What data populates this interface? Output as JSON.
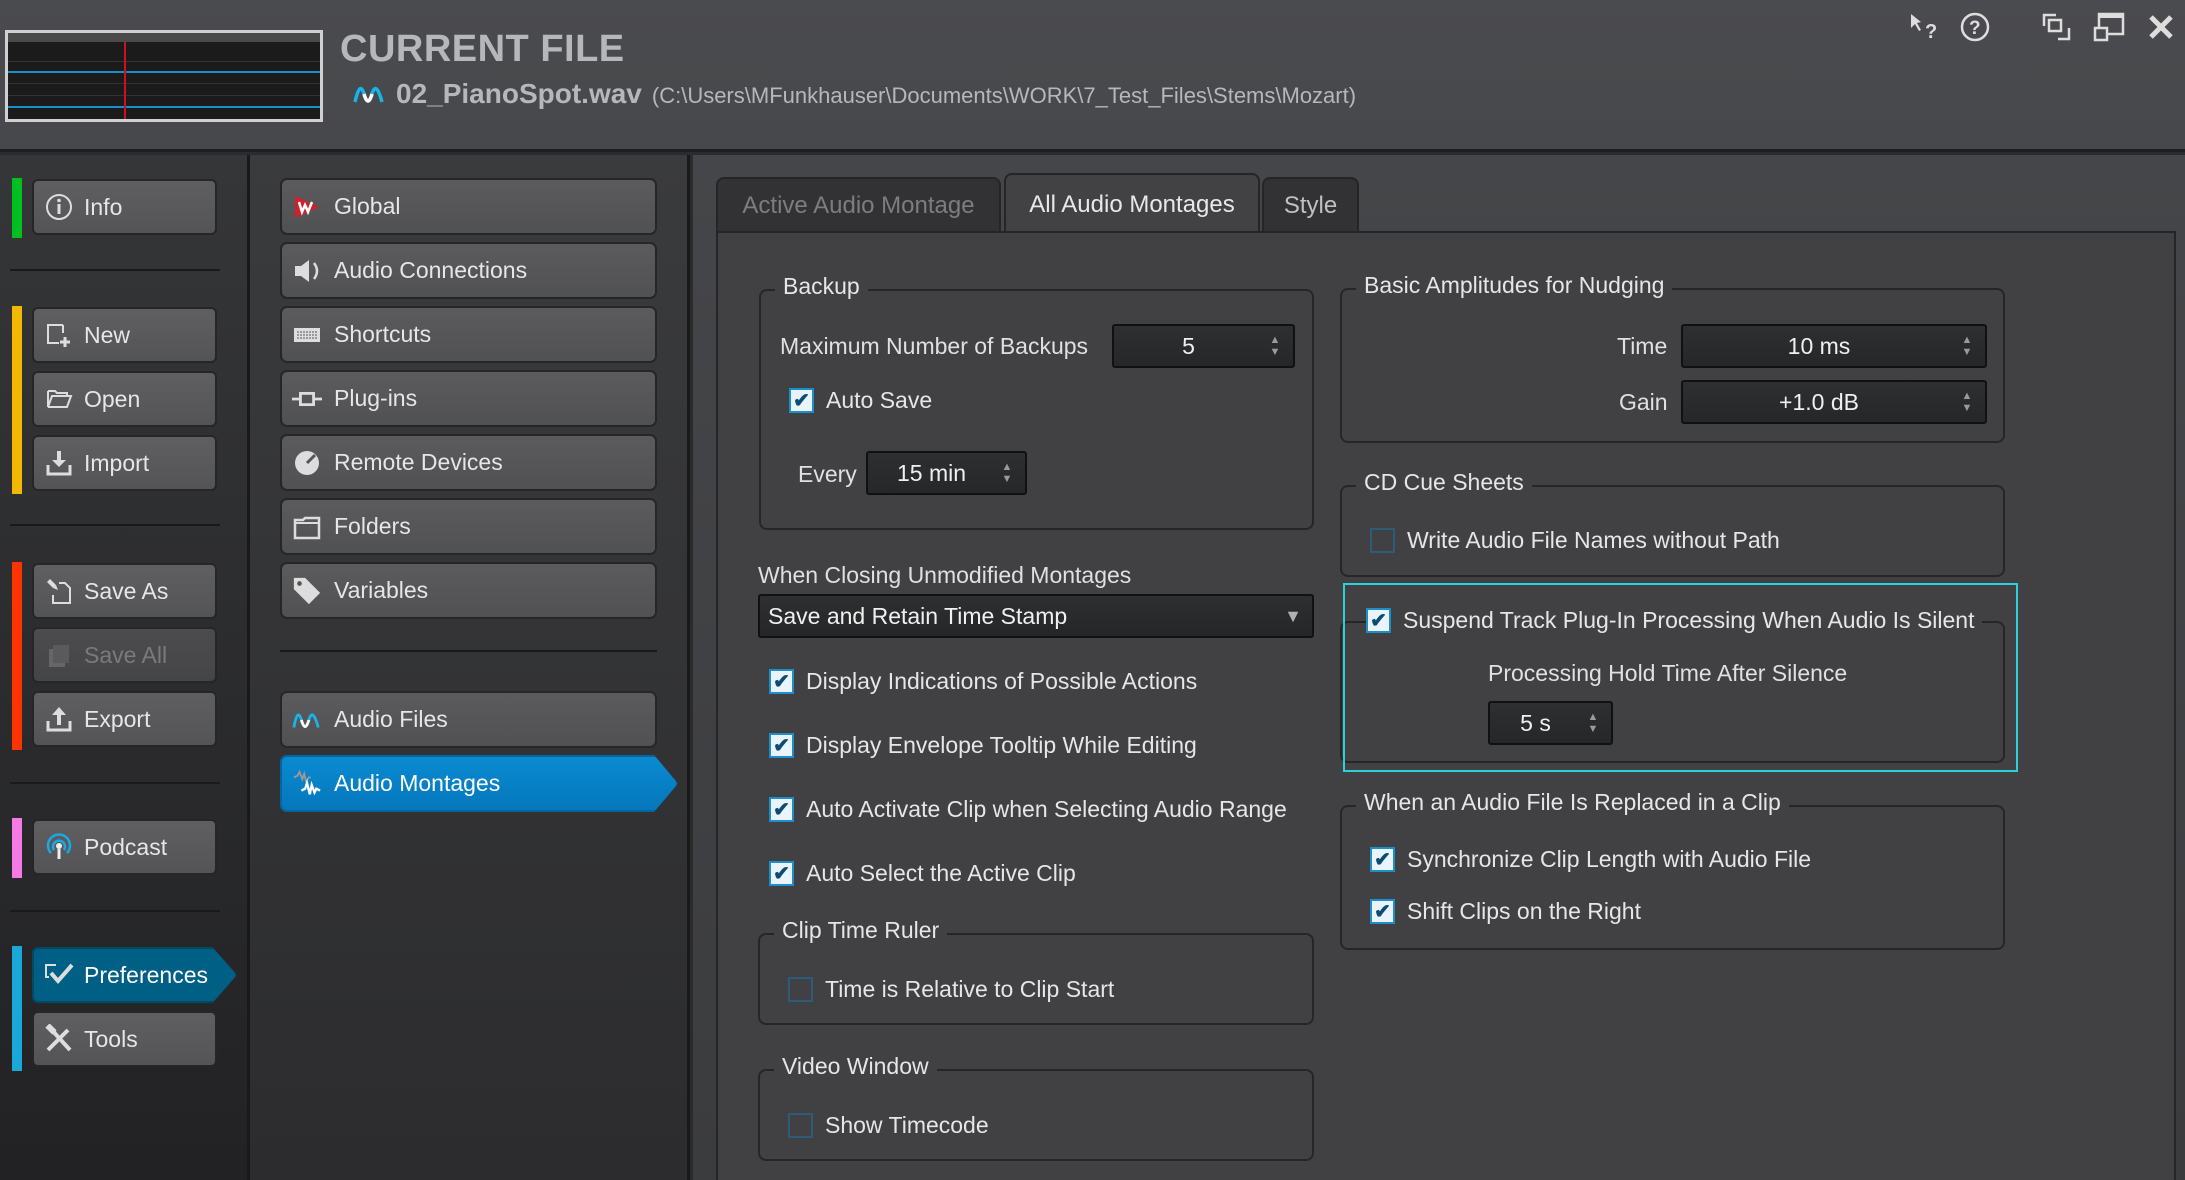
{
  "header": {
    "title": "CURRENT FILE",
    "file_name": "02_PianoSpot.wav",
    "file_path": "(C:\\Users\\MFunkhauser\\Documents\\WORK\\7_Test_Files\\Stems\\Mozart)",
    "icons": [
      "whats-this-icon",
      "help-icon",
      "restore-windows-icon",
      "maximize-icon",
      "close-icon"
    ]
  },
  "sidebar": {
    "groups": [
      {
        "color": "#00c020",
        "items": [
          {
            "label": "Info",
            "icon": "info-icon"
          }
        ]
      },
      {
        "color": "#f5b800",
        "items": [
          {
            "label": "New",
            "icon": "new-file-icon"
          },
          {
            "label": "Open",
            "icon": "folder-open-icon"
          },
          {
            "label": "Import",
            "icon": "import-icon"
          }
        ]
      },
      {
        "color": "#ff3300",
        "items": [
          {
            "label": "Save As",
            "icon": "save-as-icon"
          },
          {
            "label": "Save All",
            "icon": "save-all-icon",
            "disabled": true
          },
          {
            "label": "Export",
            "icon": "export-icon"
          }
        ]
      },
      {
        "color": "#f57ae6",
        "items": [
          {
            "label": "Podcast",
            "icon": "podcast-icon"
          }
        ]
      },
      {
        "color": "#1aa8d8",
        "items": [
          {
            "label": "Preferences",
            "icon": "preferences-icon",
            "active": true
          },
          {
            "label": "Tools",
            "icon": "tools-icon"
          }
        ]
      }
    ]
  },
  "preferences_nav": {
    "items": [
      {
        "label": "Global",
        "icon": "wavelab-logo-icon"
      },
      {
        "label": "Audio Connections",
        "icon": "speaker-icon"
      },
      {
        "label": "Shortcuts",
        "icon": "keyboard-icon"
      },
      {
        "label": "Plug-ins",
        "icon": "plugin-icon"
      },
      {
        "label": "Remote Devices",
        "icon": "knob-icon"
      },
      {
        "label": "Folders",
        "icon": "folder-icon"
      },
      {
        "label": "Variables",
        "icon": "tag-icon"
      }
    ],
    "items2": [
      {
        "label": "Audio Files",
        "icon": "waveform-icon"
      },
      {
        "label": "Audio Montages",
        "icon": "montage-icon",
        "active": true
      }
    ]
  },
  "tabs": [
    {
      "label": "Active Audio Montage",
      "state": "inactive"
    },
    {
      "label": "All Audio Montages",
      "state": "selected"
    },
    {
      "label": "Style",
      "state": "inactive"
    }
  ],
  "backup": {
    "title": "Backup",
    "max_label": "Maximum Number of Backups",
    "max_value": "5",
    "auto_save_label": "Auto Save",
    "auto_save_checked": true,
    "every_label": "Every",
    "every_value": "15 min"
  },
  "closing": {
    "label": "When Closing Unmodified Montages",
    "selected": "Save and Retain Time Stamp"
  },
  "options": [
    {
      "label": "Display Indications of Possible Actions",
      "checked": true
    },
    {
      "label": "Display Envelope Tooltip While Editing",
      "checked": true
    },
    {
      "label": "Auto Activate Clip when Selecting Audio Range",
      "checked": true
    },
    {
      "label": "Auto Select the Active Clip",
      "checked": true
    }
  ],
  "clip_time_ruler": {
    "title": "Clip Time Ruler",
    "option": "Time is Relative to Clip Start",
    "checked": false
  },
  "video_window": {
    "title": "Video Window",
    "option": "Show Timecode",
    "checked": false
  },
  "nudging": {
    "title": "Basic Amplitudes for Nudging",
    "time_label": "Time",
    "time_value": "10 ms",
    "gain_label": "Gain",
    "gain_value": "+1.0 dB"
  },
  "cd_cue": {
    "title": "CD Cue Sheets",
    "option": "Write Audio File Names without Path",
    "checked": false
  },
  "suspend": {
    "label": "Suspend Track Plug-In Processing When Audio Is Silent",
    "checked": true,
    "hold_label": "Processing Hold Time After Silence",
    "hold_value": "5 s"
  },
  "replaced": {
    "title": "When an Audio File Is Replaced in a Clip",
    "options": [
      {
        "label": "Synchronize Clip Length with Audio File",
        "checked": true
      },
      {
        "label": "Shift Clips on the Right",
        "checked": true
      }
    ]
  },
  "glyphs": {
    "check": "✔",
    "up": "▲",
    "down": "▼",
    "dropdown": "▼"
  }
}
